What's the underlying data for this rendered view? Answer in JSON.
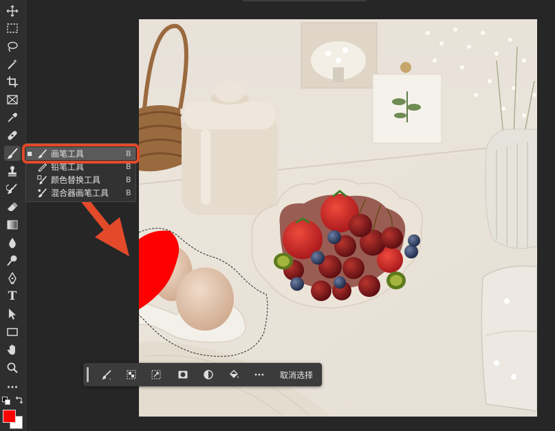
{
  "flyout": {
    "items": [
      {
        "label": "画笔工具",
        "key": "B",
        "icon": "brush-icon"
      },
      {
        "label": "铅笔工具",
        "key": "B",
        "icon": "pencil-icon"
      },
      {
        "label": "颜色替换工具",
        "key": "B",
        "icon": "color-replacement-icon"
      },
      {
        "label": "混合器画笔工具",
        "key": "B",
        "icon": "mixer-brush-icon"
      }
    ]
  },
  "context_bar": {
    "deselect_label": "取消选择"
  },
  "colors": {
    "foreground": "#ff0000",
    "background": "#ffffff",
    "annotation": "#e24a2a"
  },
  "toolbar": {
    "tools": [
      "move-icon",
      "marquee-icon",
      "lasso-icon",
      "magic-wand-icon",
      "crop-icon",
      "frame-icon",
      "eyedropper-icon",
      "healing-icon",
      "brush-icon",
      "stamp-icon",
      "history-brush-icon",
      "eraser-icon",
      "gradient-icon",
      "blur-icon",
      "dodge-icon",
      "pen-icon",
      "type-icon",
      "path-select-icon",
      "rectangle-icon",
      "hand-icon",
      "zoom-icon",
      "more-icon"
    ],
    "type_tool_glyph": "T"
  }
}
